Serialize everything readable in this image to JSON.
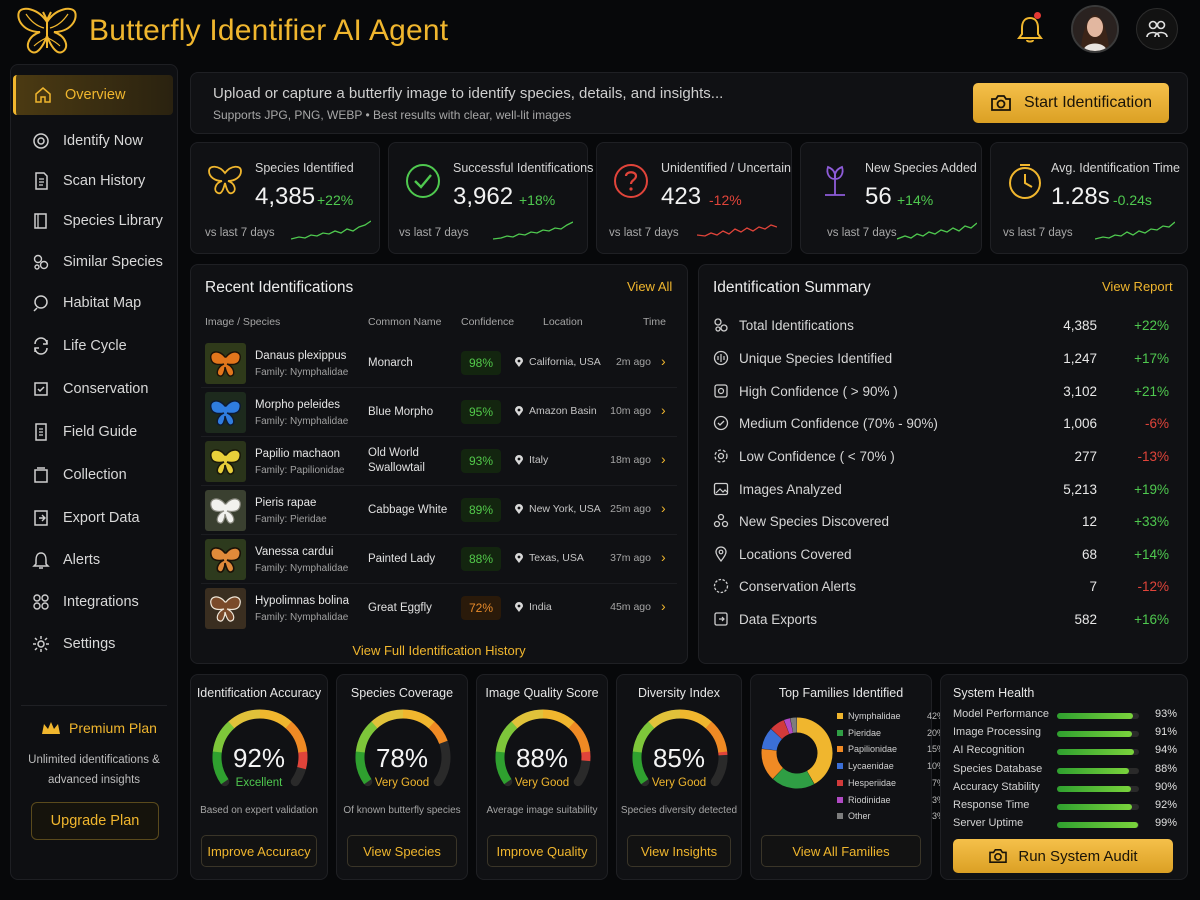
{
  "header": {
    "title": "Butterfly Identifier AI Agent",
    "notification_icon": "bell-icon",
    "team_icon": "users-icon"
  },
  "sidebar": {
    "items": [
      {
        "label": "Overview",
        "icon": "home-icon",
        "active": true
      },
      {
        "label": "Identify Now",
        "icon": "target-icon"
      },
      {
        "label": "Scan History",
        "icon": "document-icon"
      },
      {
        "label": "Species Library",
        "icon": "book-icon"
      },
      {
        "label": "Similar Species",
        "icon": "compare-icon"
      },
      {
        "label": "Habitat Map",
        "icon": "map-icon"
      },
      {
        "label": "Life Cycle",
        "icon": "cycle-icon"
      },
      {
        "label": "Conservation",
        "icon": "shield-icon"
      },
      {
        "label": "Field Guide",
        "icon": "guide-icon"
      },
      {
        "label": "Collection",
        "icon": "collection-icon"
      },
      {
        "label": "Export Data",
        "icon": "export-icon"
      },
      {
        "label": "Alerts",
        "icon": "bell-icon"
      },
      {
        "label": "Integrations",
        "icon": "integrations-icon"
      },
      {
        "label": "Settings",
        "icon": "gear-icon"
      }
    ],
    "premium": {
      "title": "Premium Plan",
      "description_line1": "Unlimited identifications &",
      "description_line2": "advanced insights",
      "button": "Upgrade Plan"
    }
  },
  "upload": {
    "main_text": "Upload or capture a butterfly image to identify species, details, and insights...",
    "sub_text": "Supports JPG, PNG, WEBP  •  Best results with clear, well-lit images",
    "button": "Start Identification"
  },
  "stats": [
    {
      "label": "Species Identified",
      "value": "4,385",
      "change": "+22%",
      "trend": "up",
      "vs": "vs last 7 days",
      "icon": "butterfly-icon",
      "color": "#f0b62e"
    },
    {
      "label": "Successful Identifications",
      "value": "3,962",
      "change": "+18%",
      "trend": "up",
      "vs": "vs last 7 days",
      "icon": "check-circle-icon",
      "color": "#4fc94f"
    },
    {
      "label": "Unidentified / Uncertain",
      "value": "423",
      "change": "-12%",
      "trend": "down",
      "vs": "vs last 7 days",
      "icon": "question-circle-icon",
      "color": "#e0443a"
    },
    {
      "label": "New Species Added",
      "value": "56",
      "change": "+14%",
      "trend": "up",
      "vs": "vs last 7 days",
      "icon": "sprout-icon",
      "color": "#8e5cd9"
    },
    {
      "label": "Avg. Identification Time",
      "value": "1.28s",
      "change": "-0.24s",
      "trend": "up",
      "vs": "vs last 7 days",
      "icon": "clock-icon",
      "color": "#f0b62e"
    }
  ],
  "recent": {
    "title": "Recent Identifications",
    "view_all": "View All",
    "columns": [
      "Image / Species",
      "Common Name",
      "Confidence",
      "Location",
      "Time"
    ],
    "rows": [
      {
        "species": "Danaus plexippus",
        "family": "Family: Nymphalidae",
        "common": "Monarch",
        "confidence": "98%",
        "level": "hi",
        "location": "California, USA",
        "time": "2m ago"
      },
      {
        "species": "Morpho peleides",
        "family": "Family: Nymphalidae",
        "common": "Blue Morpho",
        "confidence": "95%",
        "level": "hi",
        "location": "Amazon Basin",
        "time": "10m ago"
      },
      {
        "species": "Papilio machaon",
        "family": "Family: Papilionidae",
        "common": "Old World Swallowtail",
        "confidence": "93%",
        "level": "hi",
        "location": "Italy",
        "time": "18m ago"
      },
      {
        "species": "Pieris rapae",
        "family": "Family: Pieridae",
        "common": "Cabbage White",
        "confidence": "89%",
        "level": "hi",
        "location": "New York, USA",
        "time": "25m ago"
      },
      {
        "species": "Vanessa cardui",
        "family": "Family: Nymphalidae",
        "common": "Painted Lady",
        "confidence": "88%",
        "level": "hi",
        "location": "Texas, USA",
        "time": "37m ago"
      },
      {
        "species": "Hypolimnas bolina",
        "family": "Family: Nymphalidae",
        "common": "Great Eggfly",
        "confidence": "72%",
        "level": "mid",
        "location": "India",
        "time": "45m ago"
      }
    ],
    "full_history": "View Full Identification History"
  },
  "summary": {
    "title": "Identification Summary",
    "view_report": "View Report",
    "rows": [
      {
        "label": "Total Identifications",
        "value": "4,385",
        "change": "+22%",
        "trend": "up",
        "icon": "stack-icon"
      },
      {
        "label": "Unique Species Identified",
        "value": "1,247",
        "change": "+17%",
        "trend": "up",
        "icon": "fingerprint-icon"
      },
      {
        "label": "High Confidence ( > 90% )",
        "value": "3,102",
        "change": "+21%",
        "trend": "up",
        "icon": "badge-icon"
      },
      {
        "label": "Medium Confidence (70% - 90%)",
        "value": "1,006",
        "change": "-6%",
        "trend": "down",
        "icon": "badge-icon"
      },
      {
        "label": "Low Confidence ( < 70% )",
        "value": "277",
        "change": "-13%",
        "trend": "down",
        "icon": "gear-icon"
      },
      {
        "label": "Images Analyzed",
        "value": "5,213",
        "change": "+19%",
        "trend": "up",
        "icon": "image-icon"
      },
      {
        "label": "New Species Discovered",
        "value": "12",
        "change": "+33%",
        "trend": "up",
        "icon": "cluster-icon"
      },
      {
        "label": "Locations Covered",
        "value": "68",
        "change": "+14%",
        "trend": "up",
        "icon": "pin-icon"
      },
      {
        "label": "Conservation Alerts",
        "value": "7",
        "change": "-12%",
        "trend": "down",
        "icon": "alert-circle-icon"
      },
      {
        "label": "Data Exports",
        "value": "582",
        "change": "+16%",
        "trend": "up",
        "icon": "export-icon"
      }
    ]
  },
  "gauges": [
    {
      "title": "Identification Accuracy",
      "value": "92%",
      "percent": 92,
      "rating": "Excellent",
      "rating_color": "#4fc94f",
      "description": "Based on expert validation",
      "button": "Improve Accuracy"
    },
    {
      "title": "Species Coverage",
      "value": "78%",
      "percent": 78,
      "rating": "Very Good",
      "rating_color": "#f0b62e",
      "description": "Of known butterfly species",
      "button": "View Species"
    },
    {
      "title": "Image Quality Score",
      "value": "88%",
      "percent": 88,
      "rating": "Very Good",
      "rating_color": "#f0b62e",
      "description": "Average image suitability",
      "button": "Improve Quality"
    },
    {
      "title": "Diversity Index",
      "value": "85%",
      "percent": 85,
      "rating": "Very Good",
      "rating_color": "#f0b62e",
      "description": "Species diversity detected",
      "button": "View Insights"
    }
  ],
  "chart_data": {
    "type": "pie",
    "title": "Top Families Identified",
    "categories": [
      "Nymphalidae",
      "Pieridae",
      "Papilionidae",
      "Lycaenidae",
      "Hesperiidae",
      "Riodinidae",
      "Other"
    ],
    "values": [
      42,
      20,
      15,
      10,
      7,
      3,
      3
    ],
    "colors": [
      "#f0b62e",
      "#2f9e44",
      "#f08a24",
      "#3b6fd6",
      "#d23a3a",
      "#b14ac4",
      "#7d7d7d"
    ],
    "labels": [
      "42%",
      "20%",
      "15%",
      "10%",
      "7%",
      "3%",
      "3%"
    ],
    "donut": true,
    "legend": "right",
    "button": "View All Families"
  },
  "health": {
    "title": "System Health",
    "rows": [
      {
        "label": "Model Performance",
        "percent": 93,
        "value": "93%"
      },
      {
        "label": "Image Processing",
        "percent": 91,
        "value": "91%"
      },
      {
        "label": "AI Recognition",
        "percent": 94,
        "value": "94%"
      },
      {
        "label": "Species Database",
        "percent": 88,
        "value": "88%"
      },
      {
        "label": "Accuracy Stability",
        "percent": 90,
        "value": "90%"
      },
      {
        "label": "Response Time",
        "percent": 92,
        "value": "92%"
      },
      {
        "label": "Server Uptime",
        "percent": 99,
        "value": "99%"
      }
    ],
    "button": "Run System Audit"
  }
}
